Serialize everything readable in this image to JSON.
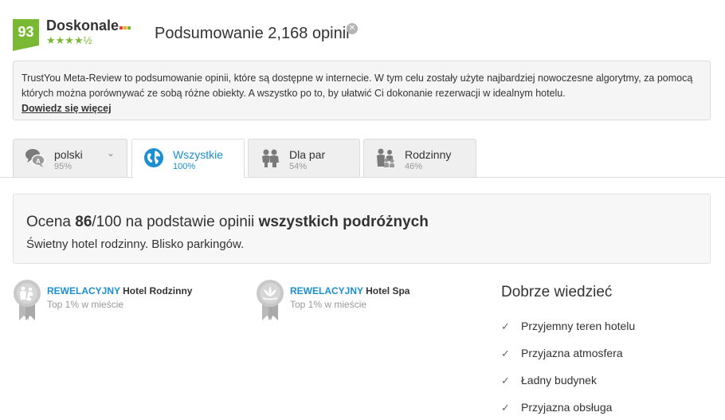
{
  "header": {
    "score": "93",
    "rating_label": "Doskonale",
    "stars": "★★★★½",
    "summary_title": "Podsumowanie 2,168 opinii",
    "brand_dot_colors": [
      "#e8442f",
      "#f6a81b",
      "#7ab934"
    ]
  },
  "info": {
    "text": "TrustYou Meta-Review to podsumowanie opinii, które są dostępne w internecie. W tym celu zostały użyte najbardziej nowoczesne algorytmy, za pomocą których można porównywać ze sobą różne obiekty. A wszystko po to, by ułatwić Ci dokonanie rezerwacji w idealnym hotelu.",
    "link": "Dowiedz się więcej"
  },
  "tabs": [
    {
      "label": "polski",
      "pct": "95%",
      "icon": "language-icon"
    },
    {
      "label": "Wszystkie",
      "pct": "100%",
      "icon": "globe-icon"
    },
    {
      "label": "Dla par",
      "pct": "54%",
      "icon": "couple-icon"
    },
    {
      "label": "Rodzinny",
      "pct": "46%",
      "icon": "family-icon"
    }
  ],
  "overview": {
    "prefix": "Ocena ",
    "score": "86",
    "suffix": "/100 na podstawie opinii ",
    "group": "wszystkich podróżnych",
    "summary": "Świetny hotel rodzinny. Blisko parkingów."
  },
  "badges": [
    {
      "highlight": "REWELACYJNY",
      "title": " Hotel Rodzinny",
      "sub": "Top 1% w mieście",
      "icon": "family-award-icon"
    },
    {
      "highlight": "REWELACYJNY",
      "title": " Hotel Spa",
      "sub": "Top 1% w mieście",
      "icon": "spa-award-icon"
    }
  ],
  "good_to_know": {
    "title": "Dobrze wiedzieć",
    "items": [
      "Przyjemny teren hotelu",
      "Przyjazna atmosfera",
      "Ładny budynek",
      "Przyjazna obsługa"
    ]
  },
  "colors": {
    "accent": "#1a8fd1",
    "score_green": "#7ab934"
  }
}
